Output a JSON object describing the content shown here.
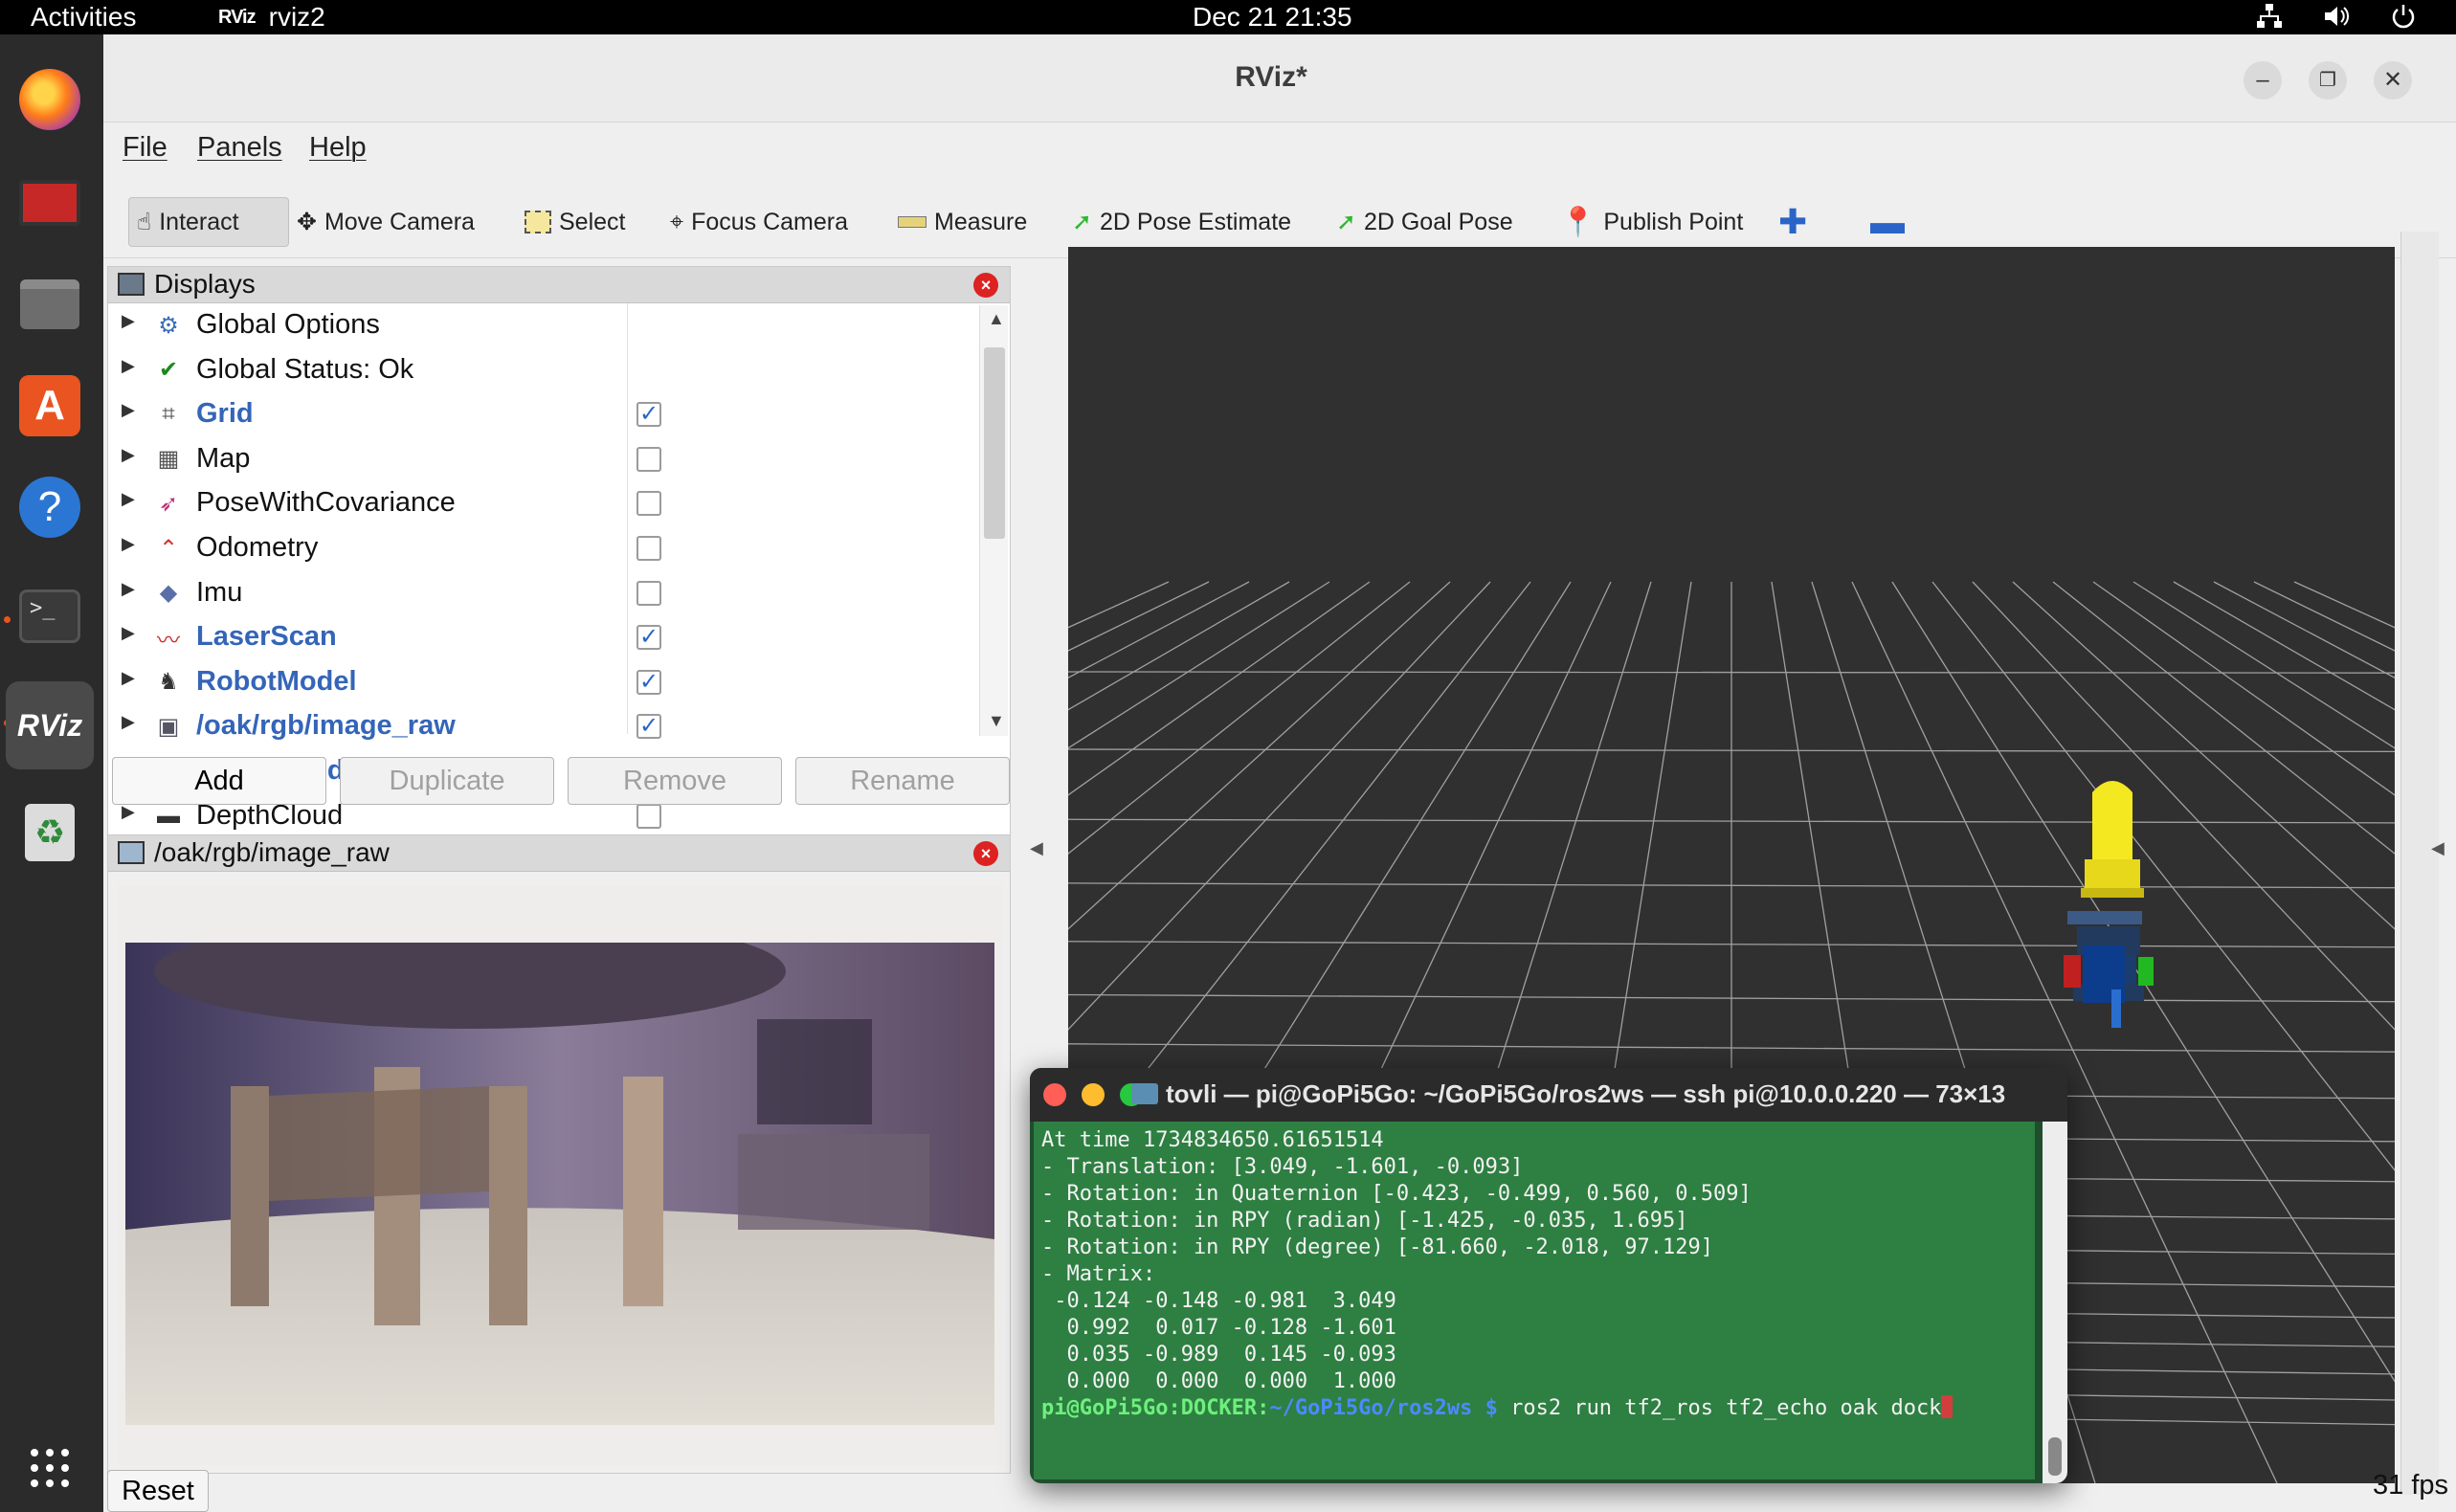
{
  "topbar": {
    "activities": "Activities",
    "app_name": "rviz2",
    "app_badge": "RViz",
    "clock": "Dec 21  21:35",
    "tray_icons": [
      "network-icon",
      "volume-icon",
      "power-icon"
    ]
  },
  "dock": {
    "items": [
      "firefox",
      "video-editor",
      "files",
      "app-center",
      "help",
      "terminal",
      "rviz",
      "trash"
    ],
    "rviz_label": "RViz",
    "apps_grid": "show-apps"
  },
  "window": {
    "title": "RViz*"
  },
  "menu": {
    "file": "File",
    "panels": "Panels",
    "help": "Help"
  },
  "toolbar": {
    "interact": "Interact",
    "move_camera": "Move Camera",
    "select": "Select",
    "focus_camera": "Focus Camera",
    "measure": "Measure",
    "pose_estimate": "2D Pose Estimate",
    "goal_pose": "2D Goal Pose",
    "publish_point": "Publish Point"
  },
  "displays": {
    "title": "Displays",
    "items": [
      {
        "label": "Global Options",
        "checked": null,
        "enabled_style": false
      },
      {
        "label": "Global Status: Ok",
        "checked": null,
        "enabled_style": false
      },
      {
        "label": "Grid",
        "checked": true,
        "enabled_style": true
      },
      {
        "label": "Map",
        "checked": false,
        "enabled_style": false
      },
      {
        "label": "PoseWithCovariance",
        "checked": false,
        "enabled_style": false
      },
      {
        "label": "Odometry",
        "checked": false,
        "enabled_style": false
      },
      {
        "label": "Imu",
        "checked": false,
        "enabled_style": false
      },
      {
        "label": "LaserScan",
        "checked": true,
        "enabled_style": true
      },
      {
        "label": "RobotModel",
        "checked": true,
        "enabled_style": true
      },
      {
        "label": "/oak/rgb/image_raw",
        "checked": true,
        "enabled_style": true
      },
      {
        "label": "PointCloud2",
        "checked": true,
        "enabled_style": true
      },
      {
        "label": "DepthCloud",
        "checked": false,
        "enabled_style": false
      }
    ],
    "buttons": {
      "add": "Add",
      "duplicate": "Duplicate",
      "remove": "Remove",
      "rename": "Rename"
    }
  },
  "image_panel": {
    "title": "/oak/rgb/image_raw"
  },
  "footer": {
    "reset": "Reset",
    "fps": "31 fps"
  },
  "terminal": {
    "title": "tovli — pi@GoPi5Go: ~/GoPi5Go/ros2ws — ssh pi@10.0.0.220 — 73×13",
    "lines": [
      "At time 1734834650.61651514",
      "- Translation: [3.049, -1.601, -0.093]",
      "- Rotation: in Quaternion [-0.423, -0.499, 0.560, 0.509]",
      "- Rotation: in RPY (radian) [-1.425, -0.035, 1.695]",
      "- Rotation: in RPY (degree) [-81.660, -2.018, 97.129]",
      "- Matrix:",
      " -0.124 -0.148 -0.981  3.049",
      "  0.992  0.017 -0.128 -1.601",
      "  0.035 -0.989  0.145 -0.093",
      "  0.000  0.000  0.000  1.000"
    ],
    "prompt_user": "pi@GoPi5Go",
    "prompt_ctx": ":DOCKER:",
    "prompt_path": "~/GoPi5Go/ros2ws",
    "prompt_sym": " $ ",
    "command": "ros2 run tf2_ros tf2_echo oak dock"
  },
  "colors": {
    "terminal_bg": "#2e7f42",
    "view_bg": "#303030",
    "enabled_display": "#3465b8",
    "robot_yellow": "#e8e020"
  }
}
